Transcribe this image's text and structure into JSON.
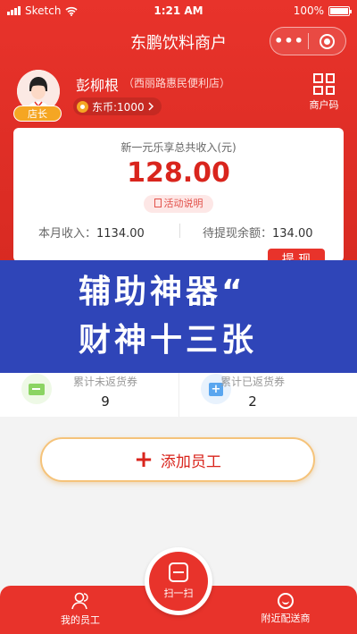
{
  "status_bar": {
    "carrier": "Sketch",
    "time": "1:21 AM",
    "battery": "100%"
  },
  "navbar": {
    "title": "东鹏饮料商户",
    "more": "•••"
  },
  "profile": {
    "name": "彭柳根",
    "store": "（西丽路惠民便利店）",
    "role": "店长",
    "coins": "东币:1000",
    "qr_label": "商户码"
  },
  "income": {
    "label": "新一元乐享总共收入(元)",
    "amount": "128.00",
    "activity_label": "活动说明",
    "month_label": "本月收入：",
    "month_value": "1134.00",
    "pending_label": "待提现余额：",
    "pending_value": "134.00",
    "withdraw_label": "提 现"
  },
  "banner": {
    "line1": "辅助神器“",
    "line2": "财神十三张"
  },
  "coupons": [
    {
      "label": "累计未返货券",
      "value": "9"
    },
    {
      "label": "累计已返货券",
      "value": "2"
    }
  ],
  "add_employee": {
    "plus": "+",
    "label": "添加员工"
  },
  "tabbar": {
    "my_staff": "我的员工",
    "scan": "扫一扫",
    "nearby": "附近配送商"
  },
  "colors": {
    "primary": "#e8332b",
    "banner": "#2f45b8",
    "accent": "#f5a623"
  }
}
